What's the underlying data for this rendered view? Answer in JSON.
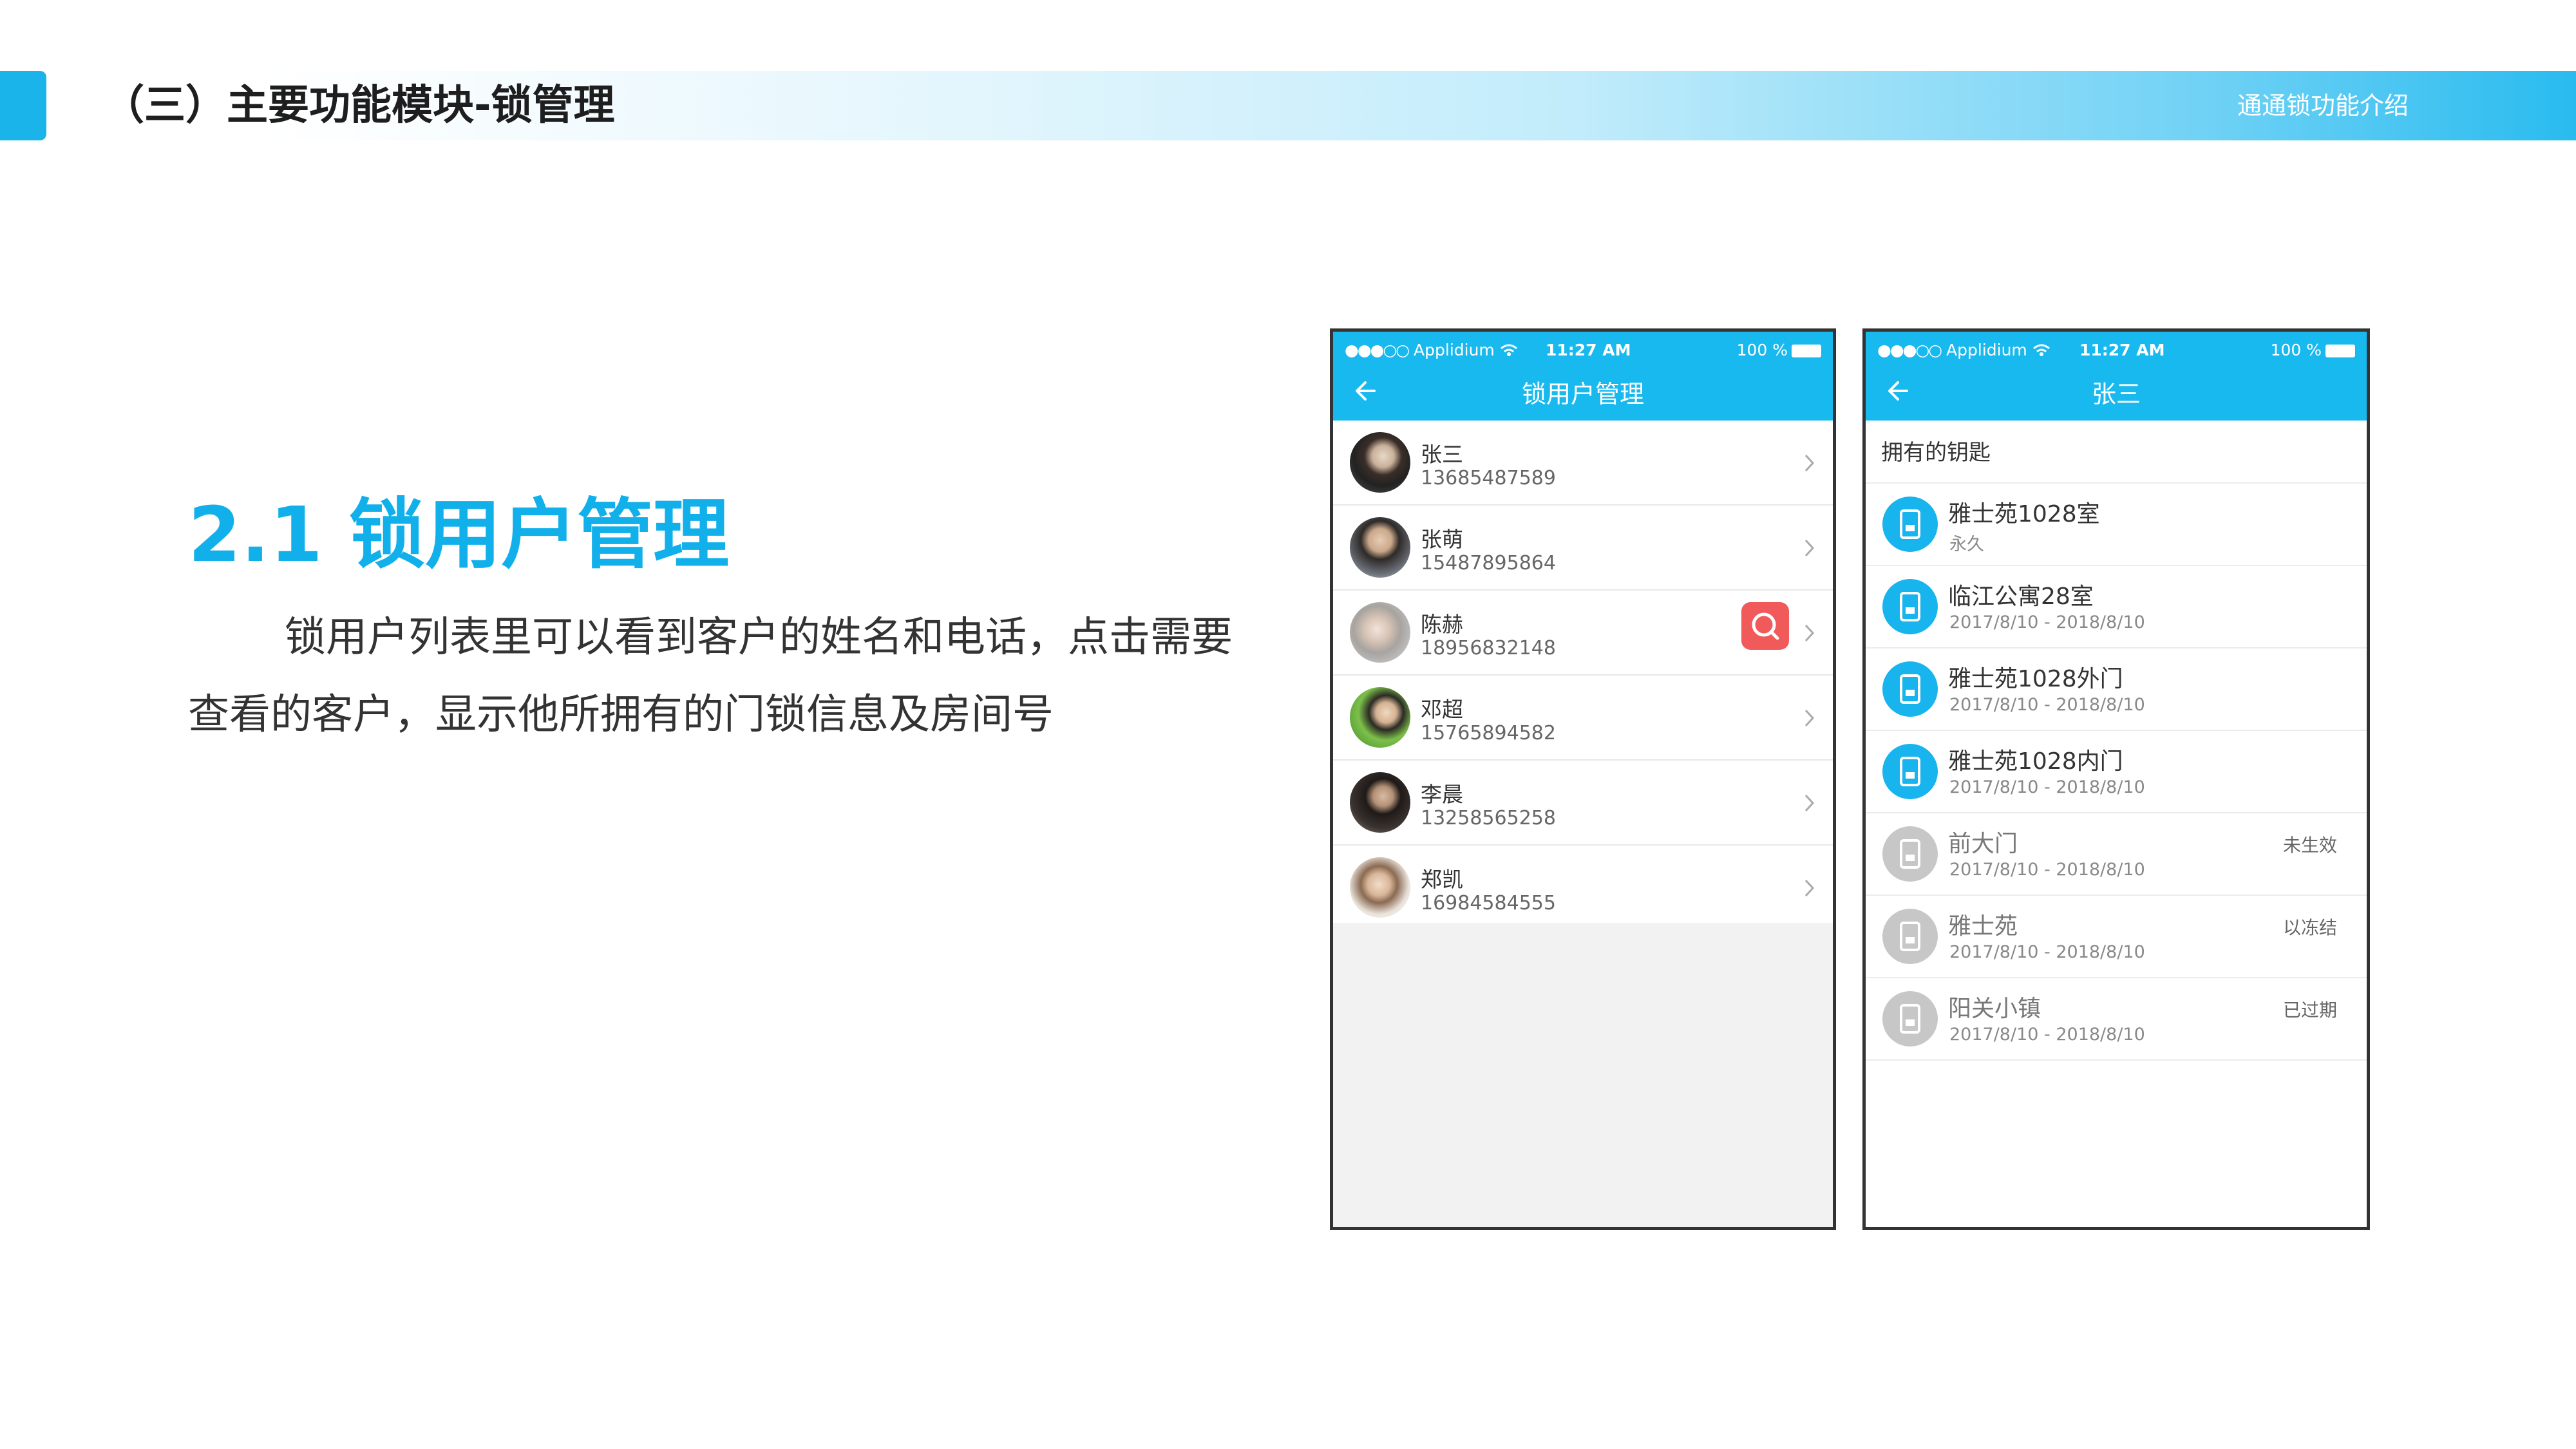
{
  "header": {
    "title": "（三）主要功能模块-锁管理",
    "subtitle": "通通锁功能介绍"
  },
  "section": {
    "title": "2.1 锁用户管理",
    "description": "锁用户列表里可以看到客户的姓名和电话，点击需要查看的客户，显示他所拥有的门锁信息及房间号"
  },
  "status_bar": {
    "dots": "●●●○○",
    "carrier": "Applidium",
    "time": "11:27 AM",
    "battery": "100 %"
  },
  "user_list_screen": {
    "title": "锁用户管理",
    "users": [
      {
        "name": "张三",
        "phone": "13685487589"
      },
      {
        "name": "张萌",
        "phone": "15487895864"
      },
      {
        "name": "陈赫",
        "phone": "18956832148"
      },
      {
        "name": "邓超",
        "phone": "15765894582"
      },
      {
        "name": "李晨",
        "phone": "13258565258"
      },
      {
        "name": "郑凯",
        "phone": "16984584555"
      }
    ]
  },
  "user_detail_screen": {
    "title": "张三",
    "section_label": "拥有的钥匙",
    "keys": [
      {
        "name": "雅士苑1028室",
        "period": "永久",
        "status": "",
        "active": true
      },
      {
        "name": "临江公寓28室",
        "period": "2017/8/10 - 2018/8/10",
        "status": "",
        "active": true
      },
      {
        "name": "雅士苑1028外门",
        "period": "2017/8/10 - 2018/8/10",
        "status": "",
        "active": true
      },
      {
        "name": "雅士苑1028内门",
        "period": "2017/8/10 - 2018/8/10",
        "status": "",
        "active": true
      },
      {
        "name": "前大门",
        "period": "2017/8/10 - 2018/8/10",
        "status": "未生效",
        "active": false
      },
      {
        "name": "雅士苑",
        "period": "2017/8/10 - 2018/8/10",
        "status": "以冻结",
        "active": false
      },
      {
        "name": "阳关小镇",
        "period": "2017/8/10 - 2018/8/10",
        "status": "已过期",
        "active": false
      }
    ]
  },
  "colors": {
    "accent": "#18b9ef",
    "title_blue": "#11b0ea",
    "search": "#f05a5a",
    "inactive": "#c7c7c7"
  }
}
